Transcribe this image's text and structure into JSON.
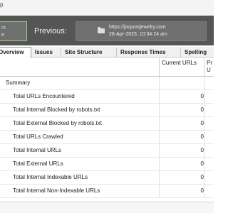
{
  "top": {
    "fragment": "p"
  },
  "compare": {
    "current_lines": [
      "m",
      "e"
    ],
    "previous_label": "Previous:",
    "previous_url": "https://jazpostjewelry.com",
    "previous_date": "28-Apr-2023, 10:34:24 am"
  },
  "tabs": [
    {
      "label": "Overview",
      "active": true
    },
    {
      "label": "Issues",
      "active": false
    },
    {
      "label": "Site Structure",
      "active": false
    },
    {
      "label": "Response Times",
      "active": false
    },
    {
      "label": "Spelling",
      "active": false
    }
  ],
  "table": {
    "columns": {
      "current": "Current URLs",
      "previous": "Pr U"
    },
    "section": "Summary",
    "rows": [
      {
        "label": "Total URLs Encountered",
        "current": "0"
      },
      {
        "label": "Total Internal Blocked by robots.txt",
        "current": "0"
      },
      {
        "label": "Total External Blocked by robots.txt",
        "current": "0"
      },
      {
        "label": "Total URLs Crawled",
        "current": "0"
      },
      {
        "label": "Total Internal URLs",
        "current": "0"
      },
      {
        "label": "Total External URLs",
        "current": "0"
      },
      {
        "label": "Total Internal Indexable URLs",
        "current": "0"
      },
      {
        "label": "Total Internal Non-Indexable URLs",
        "current": "0"
      }
    ]
  }
}
